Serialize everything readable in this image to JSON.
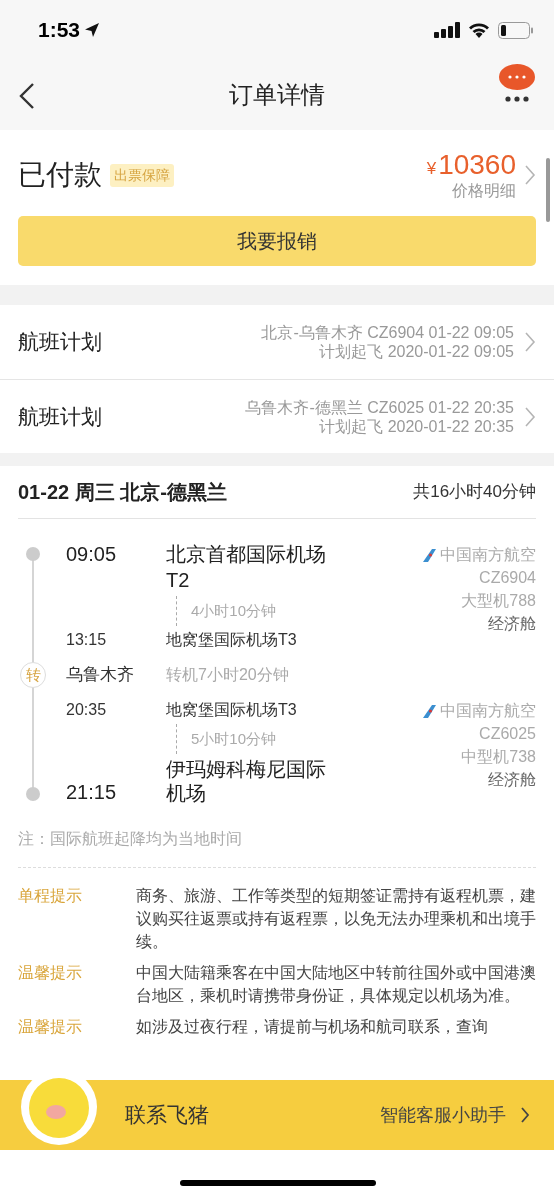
{
  "status_bar": {
    "time": "1:53"
  },
  "nav": {
    "title": "订单详情"
  },
  "payment": {
    "status": "已付款",
    "badge": "出票保障",
    "currency": "¥",
    "amount": "10360",
    "detail_link": "价格明细",
    "button": "我要报销"
  },
  "flight_plans": [
    {
      "label": "航班计划",
      "route": "北京-乌鲁木齐 CZ6904 01-22 09:05",
      "scheduled": "计划起飞 2020-01-22 09:05"
    },
    {
      "label": "航班计划",
      "route": "乌鲁木齐-德黑兰 CZ6025 01-22 20:35",
      "scheduled": "计划起飞 2020-01-22 20:35"
    }
  ],
  "itinerary": {
    "title": "01-22 周三 北京-德黑兰",
    "total": "共16小时40分钟",
    "segments": [
      {
        "depart_time": "09:05",
        "depart_airport": "北京首都国际机场T2",
        "duration": "4小时10分钟",
        "arrive_time": "13:15",
        "arrive_airport": "地窝堡国际机场T3",
        "airline": "中国南方航空",
        "flight_no": "CZ6904",
        "aircraft": "大型机788",
        "cabin": "经济舱"
      },
      {
        "depart_time": "20:35",
        "depart_airport": "地窝堡国际机场T3",
        "duration": "5小时10分钟",
        "arrive_time": "21:15",
        "arrive_airport": "伊玛姆科梅尼国际机场",
        "airline": "中国南方航空",
        "flight_no": "CZ6025",
        "aircraft": "中型机738",
        "cabin": "经济舱"
      }
    ],
    "transfer": {
      "mark": "转",
      "city": "乌鲁木齐",
      "wait": "转机7小时20分钟"
    },
    "note": "注：国际航班起降均为当地时间"
  },
  "tips": [
    {
      "label": "单程提示",
      "text": "商务、旅游、工作等类型的短期签证需持有返程机票，建议购买往返票或持有返程票，以免无法办理乘机和出境手续。"
    },
    {
      "label": "温馨提示",
      "text": "中国大陆籍乘客在中国大陆地区中转前往国外或中国港澳台地区，乘机时请携带身份证，具体规定以机场为准。"
    },
    {
      "label": "温馨提示",
      "text": "如涉及过夜行程，请提前与机场和航司联系，查询"
    }
  ],
  "contact_bar": {
    "label": "联系飞猪",
    "assistant": "智能客服小助手"
  }
}
